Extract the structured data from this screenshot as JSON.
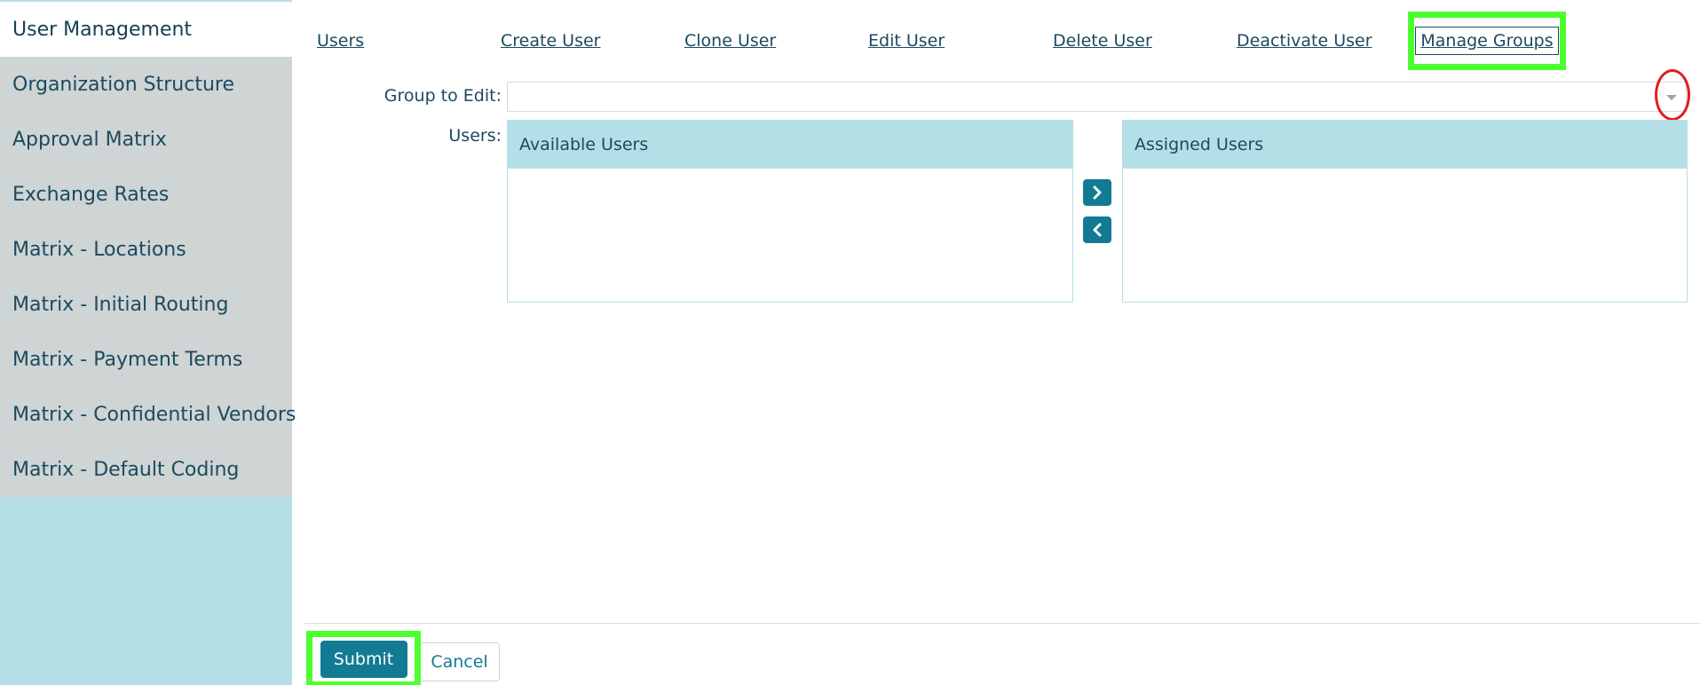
{
  "sidebar": {
    "items": [
      {
        "label": "User Management"
      },
      {
        "label": "Organization Structure"
      },
      {
        "label": "Approval Matrix"
      },
      {
        "label": "Exchange Rates"
      },
      {
        "label": "Matrix - Locations"
      },
      {
        "label": "Matrix - Initial Routing"
      },
      {
        "label": "Matrix - Payment Terms"
      },
      {
        "label": "Matrix - Confidential Vendors"
      },
      {
        "label": "Matrix - Default Coding"
      }
    ]
  },
  "nav": {
    "users": "Users",
    "create_user": "Create User",
    "clone_user": "Clone User",
    "edit_user": "Edit User",
    "delete_user": "Delete User",
    "deactivate_user": "Deactivate User",
    "manage_groups": "Manage Groups"
  },
  "form": {
    "group_label": "Group to Edit:",
    "group_value": "",
    "users_label": "Users:",
    "available_title": "Available Users",
    "assigned_title": "Assigned Users"
  },
  "footer": {
    "submit": "Submit",
    "cancel": "Cancel"
  },
  "colors": {
    "accent": "#137a93",
    "sidebar_bg": "#b5dfe6",
    "highlight_green": "#4cff2e",
    "highlight_red": "#e41b1b"
  }
}
